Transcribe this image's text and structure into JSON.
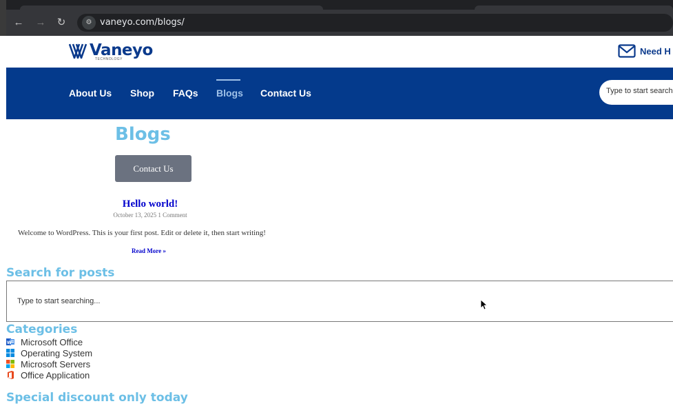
{
  "browser": {
    "url": "vaneyo.com/blogs/",
    "back_icon": "arrow-left-icon",
    "forward_icon": "arrow-right-icon",
    "reload_icon": "reload-icon",
    "site_info_icon": "tune-icon"
  },
  "header": {
    "logo_word": "Vaneyo",
    "logo_sub": "TECHNOLOGY",
    "help_label": "Need H",
    "brand_color": "#0b3a8c"
  },
  "nav": {
    "items": [
      {
        "label": "About Us"
      },
      {
        "label": "Shop"
      },
      {
        "label": "FAQs"
      },
      {
        "label": "Blogs"
      },
      {
        "label": "Contact Us"
      }
    ],
    "active": "Blogs",
    "search_placeholder": "Type to start search",
    "bar_color": "#043a8c"
  },
  "main": {
    "title": "Blogs",
    "contact_button": "Contact Us",
    "post": {
      "title": "Hello world!",
      "meta": "October 13, 2025 1 Comment",
      "excerpt": "Welcome to WordPress. This is your first post. Edit or delete it, then start writing!",
      "read_more": "Read More »"
    },
    "search": {
      "heading": "Search for posts",
      "placeholder": "Type to start searching..."
    },
    "categories": {
      "heading": "Categories",
      "items": [
        {
          "label": "Microsoft Office",
          "icon": "word-icon"
        },
        {
          "label": "Operating System",
          "icon": "windows-icon"
        },
        {
          "label": "Microsoft Servers",
          "icon": "microsoft-logo-icon"
        },
        {
          "label": "Office Application",
          "icon": "office-icon"
        }
      ]
    },
    "discount_heading": "Special discount only today"
  }
}
